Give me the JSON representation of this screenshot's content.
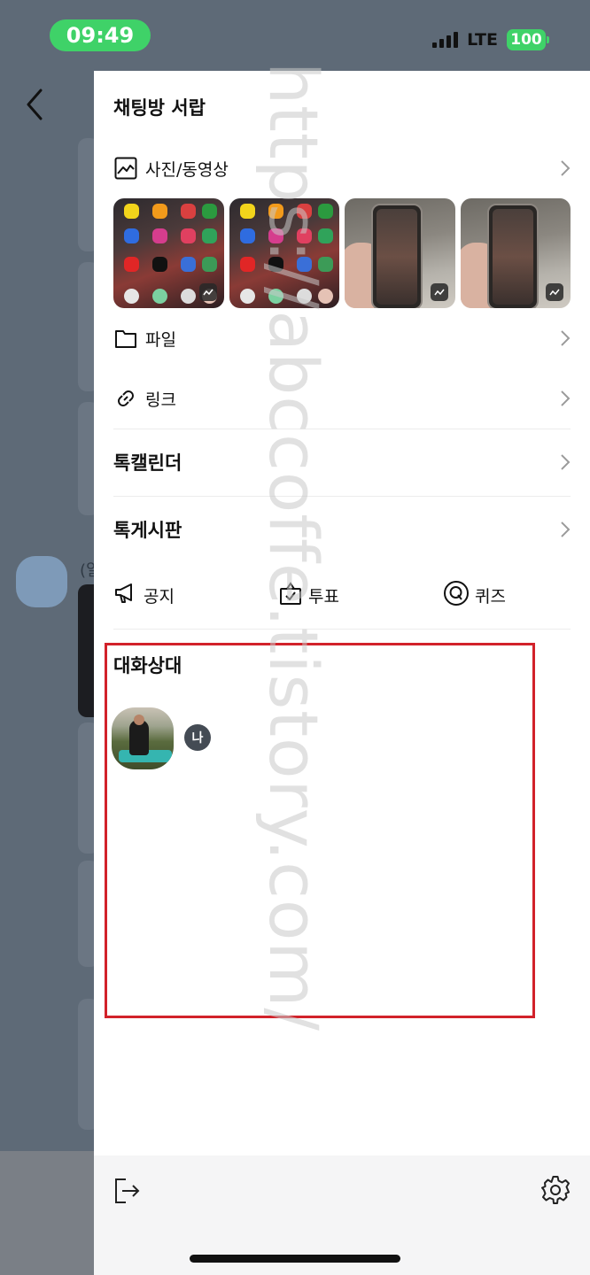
{
  "status_bar": {
    "time": "09:49",
    "network": "LTE",
    "battery": "100"
  },
  "background": {
    "paren_text": "(일"
  },
  "drawer": {
    "title": "채팅방 서랍",
    "media": {
      "label": "사진/동영상",
      "thumbnail_count": 4
    },
    "files_label": "파일",
    "links_label": "링크",
    "calendar_label": "톡캘린더",
    "board_label": "톡게시판",
    "quick_actions": [
      {
        "icon": "megaphone-icon",
        "label": "공지"
      },
      {
        "icon": "vote-box-icon",
        "label": "투표"
      },
      {
        "icon": "quiz-icon",
        "label": "퀴즈"
      }
    ],
    "members": {
      "title": "대화상대",
      "list": [
        {
          "badge": "나"
        }
      ]
    }
  },
  "watermark": "https://abccoffe.tistory.com/",
  "colors": {
    "status_green": "#3fd268",
    "highlight_red": "#d2222a",
    "overlay": "#5e6a77"
  }
}
